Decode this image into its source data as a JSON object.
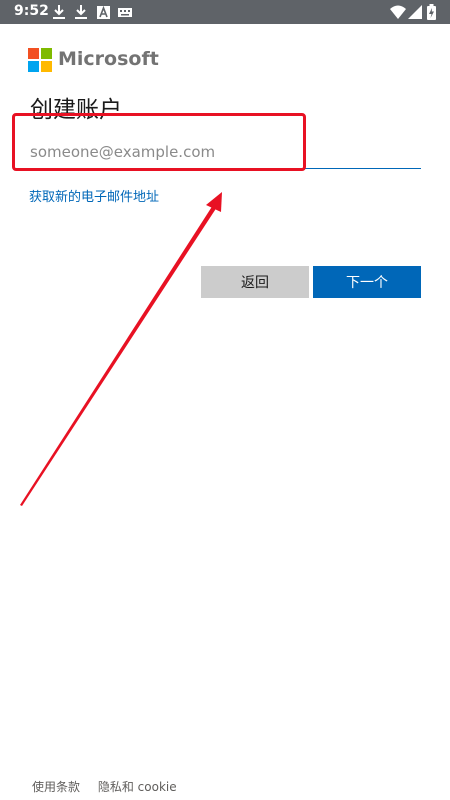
{
  "status_bar": {
    "time": "9:52",
    "left_icons": [
      "download-icon",
      "download-icon",
      "text-a-icon",
      "keyboard-icon"
    ],
    "right_icons": [
      "wifi-icon",
      "signal-icon",
      "battery-charging-icon"
    ]
  },
  "brand": {
    "name": "Microsoft",
    "logo_colors": [
      "#f25022",
      "#7fba00",
      "#00a4ef",
      "#ffb900"
    ]
  },
  "page": {
    "title": "创建账户"
  },
  "email": {
    "placeholder": "someone@example.com",
    "value": ""
  },
  "get_new_email_link": "获取新的电子邮件地址",
  "buttons": {
    "back": "返回",
    "next": "下一个"
  },
  "footer": {
    "terms": "使用条款",
    "privacy": "隐私和 cookie"
  },
  "colors": {
    "accent": "#0067b8",
    "annotation": "#e81123",
    "status_bar": "#5f6368"
  }
}
